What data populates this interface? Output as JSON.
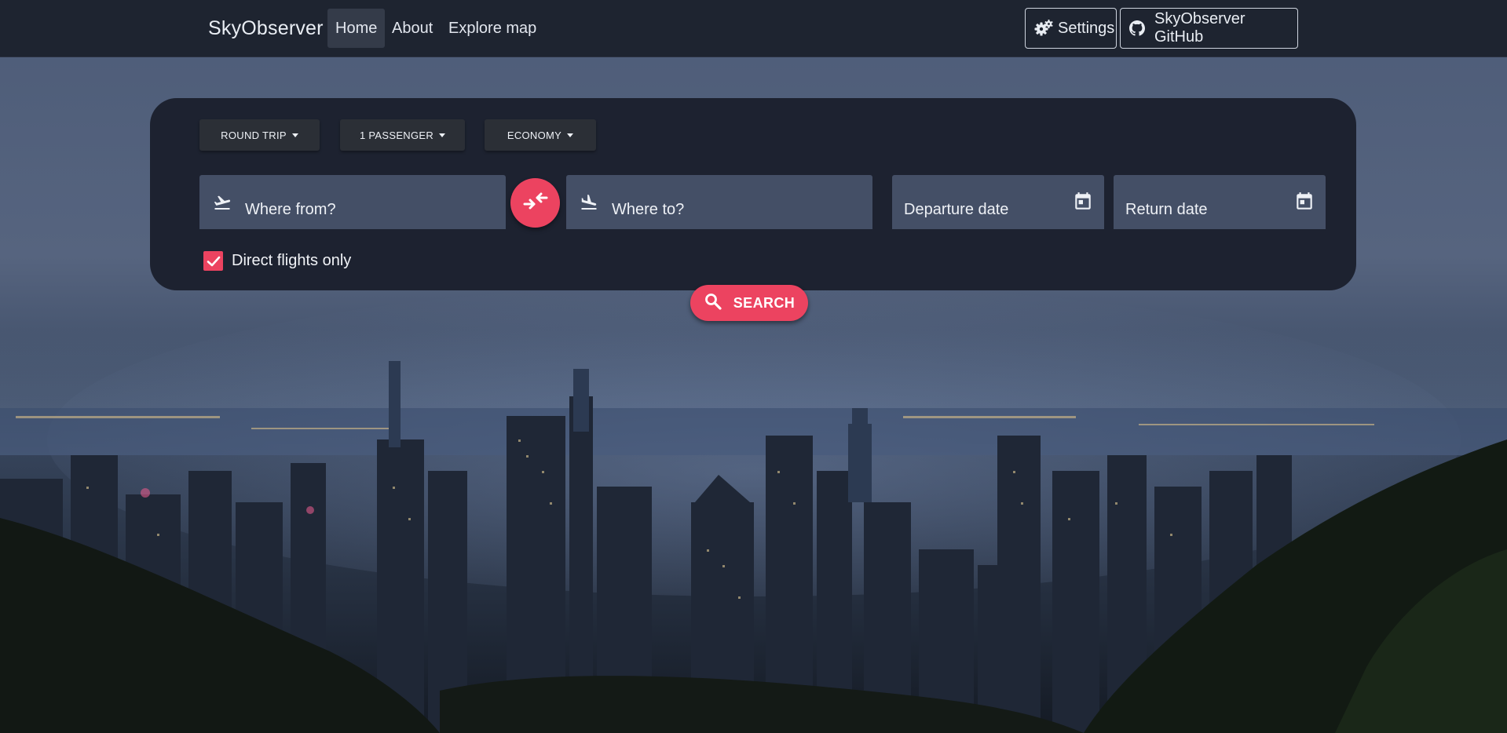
{
  "navbar": {
    "brand": "SkyObserver",
    "links": [
      {
        "label": "Home",
        "active": true
      },
      {
        "label": "About",
        "active": false
      },
      {
        "label": "Explore map",
        "active": false
      }
    ],
    "settings_label": "Settings",
    "github_label": "SkyObserver GitHub"
  },
  "search": {
    "trip_type": "ROUND TRIP",
    "passengers": "1 PASSENGER",
    "cabin_class": "ECONOMY",
    "from_placeholder": "Where from?",
    "to_placeholder": "Where to?",
    "departure_label": "Departure date",
    "return_label": "Return date",
    "direct_only_label": "Direct flights only",
    "direct_only_checked": true,
    "search_label": "SEARCH"
  },
  "colors": {
    "accent": "#ec4360",
    "navbar_bg": "#1e2430",
    "panel_bg": "#1d2230",
    "field_bg": "#444f66"
  },
  "icons": {
    "settings": "gears-icon",
    "github": "github-icon",
    "from": "flight-takeoff-icon",
    "to": "flight-land-icon",
    "swap": "swap-arrows-icon",
    "date": "calendar-icon",
    "search": "search-icon",
    "check": "check-icon"
  }
}
